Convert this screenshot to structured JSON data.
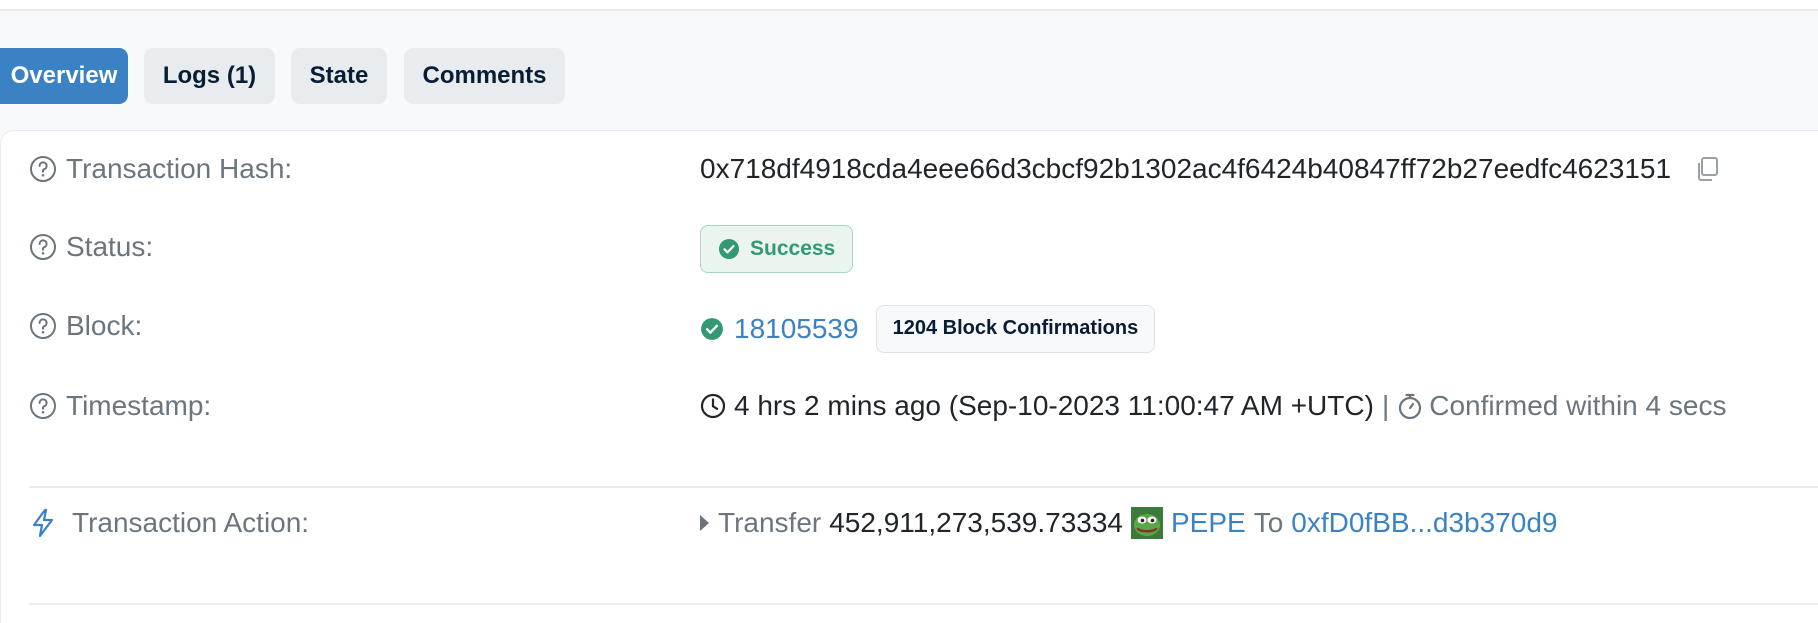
{
  "tabs": [
    {
      "label": "Overview",
      "active": true
    },
    {
      "label": "Logs (1)",
      "active": false
    },
    {
      "label": "State",
      "active": false
    },
    {
      "label": "Comments",
      "active": false
    }
  ],
  "overview": {
    "hash": {
      "label": "Transaction Hash:",
      "value": "0x718df4918cda4eee66d3cbcf92b1302ac4f6424b40847ff72b27eedfc4623151"
    },
    "status": {
      "label": "Status:",
      "value": "Success"
    },
    "block": {
      "label": "Block:",
      "number": "18105539",
      "confirmations": "1204 Block Confirmations"
    },
    "timestamp": {
      "label": "Timestamp:",
      "relative": "4 hrs 2 mins ago (Sep-10-2023 11:00:47 AM +UTC)",
      "separator": "|",
      "confirmed": "Confirmed within 4 secs"
    },
    "action": {
      "label": "Transaction Action:",
      "verb": "Transfer",
      "amount": "452,911,273,539.73334",
      "token": "PEPE",
      "to_word": "To",
      "to_address": "0xfD0fBB...d3b370d9"
    }
  },
  "colors": {
    "accent": "#3b82c4",
    "success": "#339971",
    "muted": "#6c757d"
  }
}
